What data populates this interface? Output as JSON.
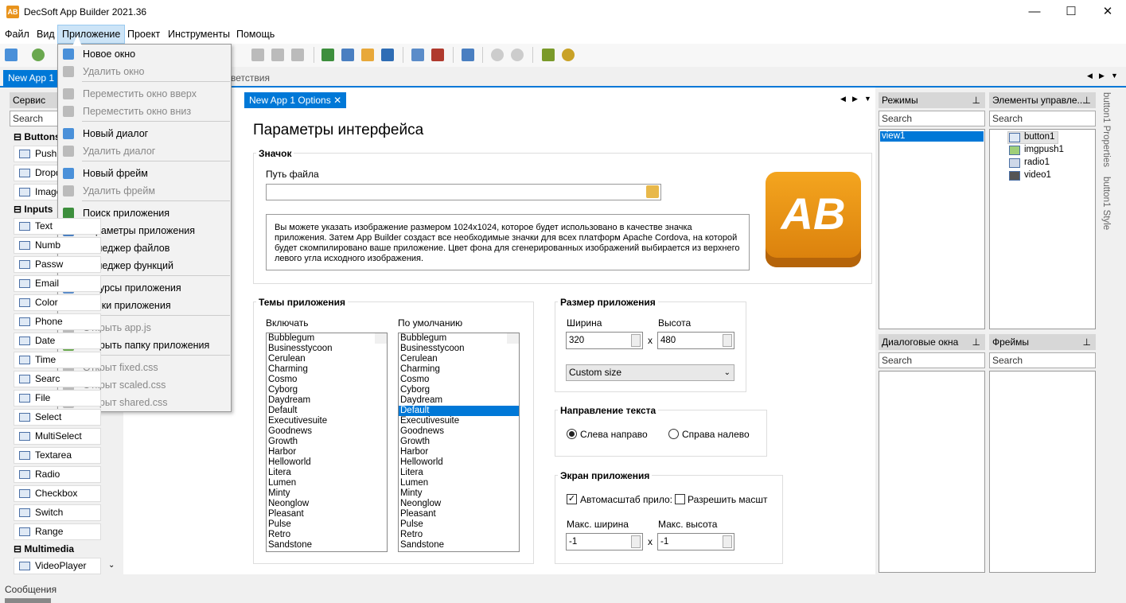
{
  "window": {
    "title": "DecSoft App Builder 2021.36",
    "app_icon": "AB",
    "min": "—",
    "max": "☐",
    "close": "✕"
  },
  "menu": [
    "Файл",
    "Вид",
    "Приложение",
    "Проект",
    "Инструменты",
    "Помощь"
  ],
  "doc_tabs": {
    "active": "New App 1",
    "close": "✕",
    "partial": "ветствия"
  },
  "toolbox": {
    "title": "Сервис",
    "search": "Search",
    "sections": {
      "buttons": "Buttons",
      "inputs": "Inputs",
      "multimedia": "Multimedia"
    },
    "buttons": [
      "Push",
      "Dropd",
      "Image"
    ],
    "inputs": [
      "Text",
      "Numb",
      "Passw",
      "Email",
      "Color",
      "Phone",
      "Date",
      "Time",
      "Searc",
      "File",
      "Select",
      "MultiSelect",
      "Textarea",
      "Radio",
      "Checkbox",
      "Switch",
      "Range"
    ],
    "multimedia": [
      "VideoPlayer"
    ]
  },
  "options": {
    "tab": "New App 1 Options",
    "tab_close": "✕",
    "heading": "Параметры интерфейса",
    "icon_group": "Значок",
    "file_path_label": "Путь файла",
    "logo_text": "AB",
    "icon_info": "Вы можете указать изображение размером 1024x1024, которое будет использовано в качестве значка приложения. Затем App Builder создаст все необходимые значки для всех платформ Apache Cordova, на которой будет скомпилировано ваше приложение. Цвет фона для сгенерированных изображений выбирается из верхнего левого угла исходного изображения.",
    "themes_group": "Темы приложения",
    "include_label": "Включать",
    "default_label": "По умолчанию",
    "themes": [
      "Bubblegum",
      "Businesstycoon",
      "Cerulean",
      "Charming",
      "Cosmo",
      "Cyborg",
      "Daydream",
      "Default",
      "Executivesuite",
      "Goodnews",
      "Growth",
      "Harbor",
      "Helloworld",
      "Litera",
      "Lumen",
      "Minty",
      "Neonglow",
      "Pleasant",
      "Pulse",
      "Retro",
      "Sandstone"
    ],
    "selected_default": "Default",
    "size_group": "Размер приложения",
    "width_label": "Ширина",
    "height_label": "Высота",
    "width": "320",
    "height": "480",
    "x": "x",
    "size_select": "Custom size",
    "dir_group": "Направление текста",
    "ltr": "Слева направо",
    "rtl": "Справа налево",
    "screen_group": "Экран приложения",
    "autoscale": "Автомасштаб прило:",
    "allow_zoom": "Разрешить масшт",
    "max_w_label": "Макс. ширина",
    "max_h_label": "Макс. высота",
    "max_w": "-1",
    "max_h": "-1"
  },
  "right": {
    "modes": "Режимы",
    "controls": "Элементы управле...",
    "dialogs": "Диалоговые окна",
    "frames": "Фреймы",
    "search": "Search",
    "pin": "📌",
    "views": [
      "view1"
    ],
    "tree": [
      "button1",
      "imgpush1",
      "radio1",
      "video1"
    ]
  },
  "vtabs": [
    "button1 Properties",
    "button1 Style"
  ],
  "status": "Сообщения",
  "dropdown": {
    "items": [
      {
        "label": "Новое окно",
        "dis": false
      },
      {
        "label": "Удалить окно",
        "dis": true
      },
      {
        "label": "Переместить окно вверх",
        "dis": true
      },
      {
        "label": "Переместить окно вниз",
        "dis": true
      },
      {
        "label": "Новый диалог",
        "dis": false
      },
      {
        "label": "Удалить диалог",
        "dis": true
      },
      {
        "label": "Новый фрейм",
        "dis": false
      },
      {
        "label": "Удалить фрейм",
        "dis": true
      },
      {
        "label": "Поиск приложения",
        "dis": false
      },
      {
        "label": "Параметры приложения",
        "dis": false
      },
      {
        "label": "Менеджер файлов",
        "dis": false
      },
      {
        "label": "Менеджер функций",
        "dis": false
      },
      {
        "label": "Ресурсы приложения",
        "dis": false
      },
      {
        "label": "Языки приложения",
        "dis": false
      },
      {
        "label": "Открыть app.js",
        "dis": true
      },
      {
        "label": "Открыть папку приложения",
        "dis": false
      },
      {
        "label": "Открыт fixed.css",
        "dis": true
      },
      {
        "label": "Открыт scaled.css",
        "dis": true
      },
      {
        "label": "Открыт shared.css",
        "dis": true
      }
    ]
  },
  "colors": {
    "accent": "#0078d7",
    "logo": "#e8931c"
  }
}
